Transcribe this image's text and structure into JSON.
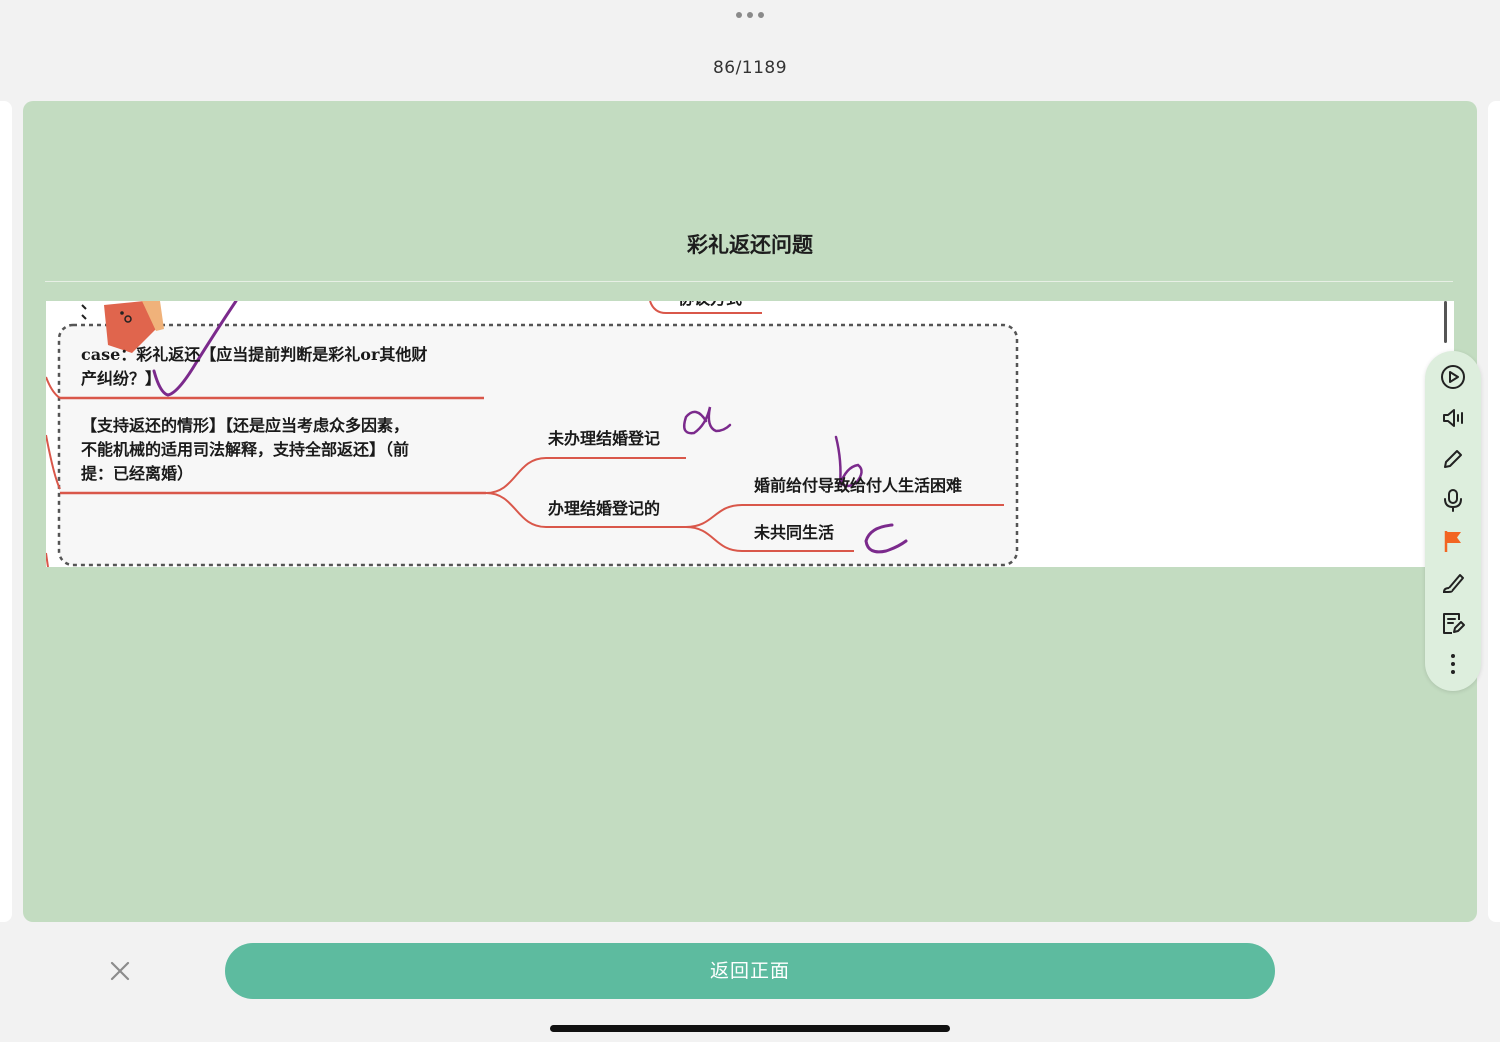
{
  "header": {
    "page_counter": "86/1189"
  },
  "card": {
    "title": "彩礼返还问题"
  },
  "mindmap": {
    "partial_top_label": "协议方式",
    "case_line1": "case：彩礼返还【应当提前判断是彩礼or其他财",
    "case_line2": "产纠纷？】",
    "support_line1": "【支持返还的情形】【还是应当考虑众多因素，",
    "support_line2": "不能机械的适用司法解释，支持全部返还】（前",
    "support_line3": "提：已经离婚）",
    "branch_not_registered": "未办理结婚登记",
    "branch_registered": "办理结婚登记的",
    "sub_hardship": "婚前给付导致给付人生活困难",
    "sub_not_cohabited": "未共同生活",
    "handwriting": [
      "a",
      "b",
      "c"
    ]
  },
  "toolbar": {
    "items": [
      "play-icon",
      "speaker-icon",
      "pencil-icon",
      "microphone-icon",
      "flag-icon",
      "brush-icon",
      "edit-note-icon",
      "more-vertical-icon"
    ],
    "flag_color": "#f26522"
  },
  "footer": {
    "back_label": "返回正面"
  },
  "colors": {
    "card_bg": "#c3dcc1",
    "accent": "#5dbb9f",
    "branch_line": "#d9574a",
    "ink": "#7b2a8c"
  }
}
